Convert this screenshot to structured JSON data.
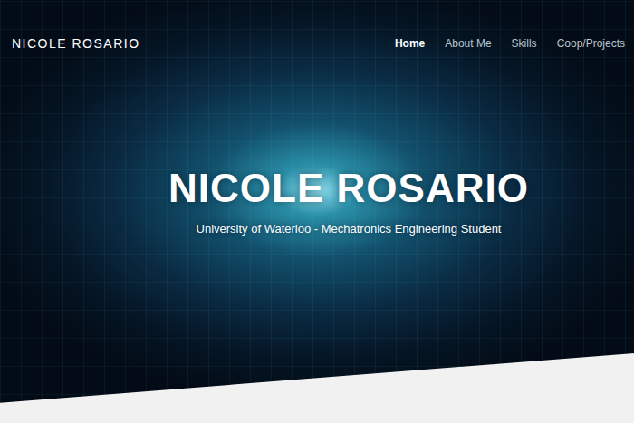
{
  "nav": {
    "logo": "NICOLE ROSARIO",
    "items": [
      {
        "label": "Home",
        "selected": true
      },
      {
        "label": "About Me",
        "selected": false
      },
      {
        "label": "Skills",
        "selected": false
      },
      {
        "label": "Coop/Projects",
        "selected": false
      }
    ]
  },
  "hero": {
    "title": "NICOLE ROSARIO",
    "subtitle": "University of Waterloo - Mechatronics Engineering Student"
  }
}
